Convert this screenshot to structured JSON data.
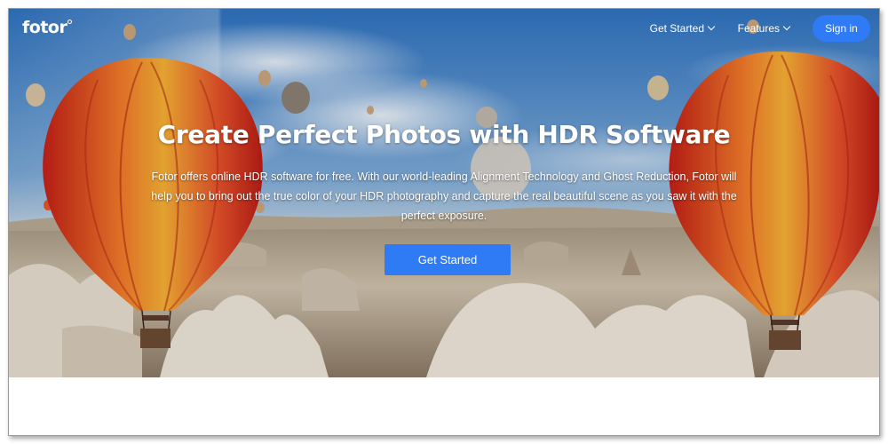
{
  "header": {
    "logo_text": "fotor",
    "nav": [
      {
        "label": "Get Started",
        "icon": "chevron-down-icon"
      },
      {
        "label": "Features",
        "icon": "chevron-down-icon"
      }
    ],
    "signin_label": "Sign in"
  },
  "hero": {
    "title": "Create Perfect Photos with HDR Software",
    "description": "Fotor offers online HDR software for free. With our world-leading Alignment Technology and Ghost Reduction, Fotor will help you to bring out the true color of your HDR photography and capture the real beautiful scene as you saw it with the perfect exposure.",
    "cta_label": "Get Started",
    "background": "hot-air-balloons-over-cappadocia-photo"
  },
  "colors": {
    "accent": "#2f7bf6",
    "sky": "#3e7fc4",
    "balloon_red": "#d9321f",
    "balloon_yellow": "#f2a52a",
    "rock": "#d8cdbd"
  }
}
